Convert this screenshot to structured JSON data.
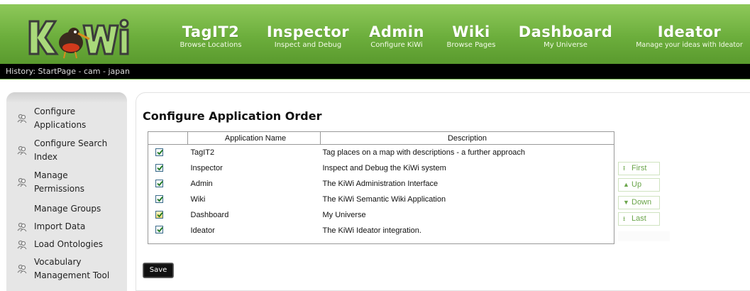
{
  "logo": {
    "text": "KiWi",
    "icon": "kiwi-bird-logo"
  },
  "nav": [
    {
      "title": "TagIT2",
      "subtitle": "Browse Locations"
    },
    {
      "title": "Inspector",
      "subtitle": "Inspect and Debug"
    },
    {
      "title": "Admin",
      "subtitle": "Configure KiWi"
    },
    {
      "title": "Wiki",
      "subtitle": "Browse Pages"
    },
    {
      "title": "Dashboard",
      "subtitle": "My Universe"
    },
    {
      "title": "Ideator",
      "subtitle": "Manage your ideas with Ideator"
    }
  ],
  "history": "History: StartPage - cam - japan",
  "sidebar": {
    "items": [
      {
        "label": "Configure Applications",
        "icon": "users-icon"
      },
      {
        "label": "Configure Search Index",
        "icon": "users-icon"
      },
      {
        "label": "Manage Permissions",
        "icon": "users-icon"
      },
      {
        "label": "Manage Groups",
        "icon": ""
      },
      {
        "label": "Import Data",
        "icon": "users-icon"
      },
      {
        "label": "Load Ontologies",
        "icon": "users-icon"
      },
      {
        "label": "Vocabulary Management Tool",
        "icon": "users-icon"
      }
    ]
  },
  "main": {
    "title": "Configure Application Order",
    "table": {
      "headers": [
        "",
        "Application Name",
        "Description"
      ],
      "rows": [
        {
          "checked": true,
          "name": "TagIT2",
          "description": "Tag places on a map with descriptions - a further approach"
        },
        {
          "checked": true,
          "name": "Inspector",
          "description": "Inspect and Debug the KiWi system"
        },
        {
          "checked": true,
          "name": "Admin",
          "description": "The KiWi Administration Interface"
        },
        {
          "checked": true,
          "name": "Wiki",
          "description": "The KiWi Semantic Wiki Application"
        },
        {
          "checked": true,
          "name": "Dashboard",
          "description": "My Universe"
        },
        {
          "checked": true,
          "name": "Ideator",
          "description": "The KiWi Ideator integration."
        }
      ]
    },
    "order_buttons": [
      {
        "label": "First",
        "icon": "first-icon"
      },
      {
        "label": "Up",
        "icon": "up-arrow-icon"
      },
      {
        "label": "Down",
        "icon": "down-arrow-icon"
      },
      {
        "label": "Last",
        "icon": "last-icon"
      }
    ],
    "save_label": "Save"
  },
  "colors": {
    "header_green": "#6cae3c",
    "history_bg": "#000000",
    "sidebar_bg": "#e6e6e6",
    "button_text_green": "#6aa54a"
  }
}
